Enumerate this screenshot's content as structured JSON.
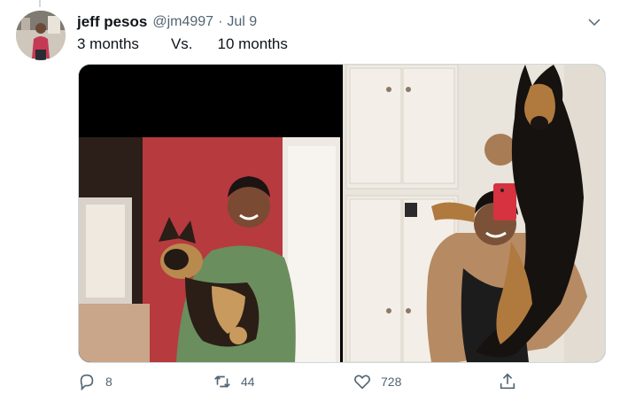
{
  "tweet": {
    "author_name": "jeff pesos",
    "handle": "@jm4997",
    "separator": "·",
    "date": "Jul 9",
    "text_parts": [
      "3 months",
      "Vs.",
      "10 months"
    ]
  },
  "actions": {
    "reply_count": "8",
    "retweet_count": "44",
    "like_count": "728"
  },
  "icons": {
    "more": "chevron-down-icon",
    "reply": "reply-icon",
    "retweet": "retweet-icon",
    "like": "heart-icon",
    "share": "share-icon"
  },
  "colors": {
    "text_primary": "#0f1419",
    "text_secondary": "#536471",
    "border": "#cfd9de"
  }
}
